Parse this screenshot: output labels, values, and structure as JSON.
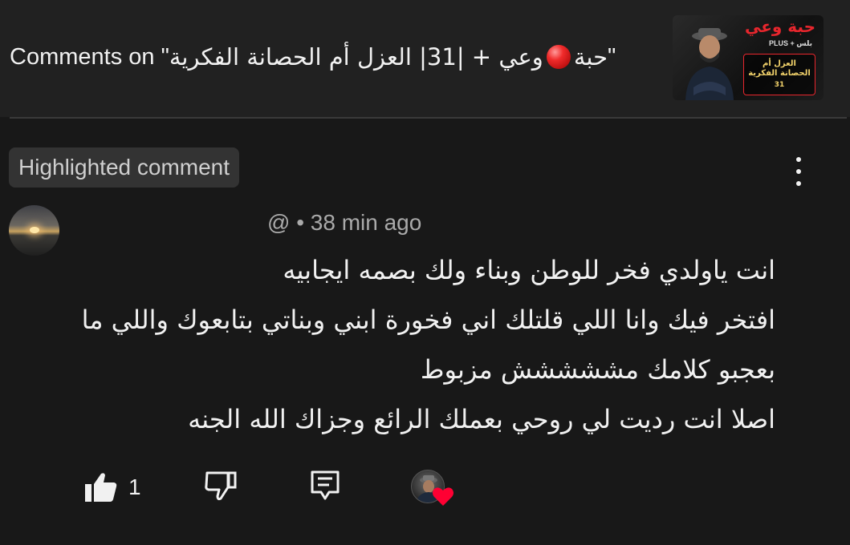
{
  "header": {
    "title_prefix": "Comments on \"",
    "title_arabic_1": "حبة",
    "title_arabic_2": "وعي + |31| العزل أم الحصانة الفكرية",
    "title_suffix": "\"",
    "thumbnail": {
      "title": "حبة وعي",
      "plus_label": "PLUS + بلس",
      "episode_title_line1": "العزل أم",
      "episode_title_line2": "الحصانة الفكرية",
      "episode_number": "31"
    }
  },
  "chip": {
    "label": "Highlighted comment"
  },
  "comment": {
    "meta": "@ • 38 min ago",
    "lines": [
      "انت ياولدي فخر للوطن وبناء ولك بصمه ايجابيه",
      "افتخر فيك وانا اللي قلتلك اني فخورة ابني وبناتي بتابعوك واللي ما",
      "بعجبو كلامك مششششش مزبوط",
      "اصلا انت رديت لي روحي بعملك الرائع وجزاك الله الجنه"
    ]
  },
  "actions": {
    "like_count": "1",
    "icons": [
      "thumbs-up-icon",
      "thumbs-down-icon",
      "reply-icon",
      "creator-heart-icon"
    ]
  },
  "colors": {
    "background": "#181818",
    "header_background": "#212121",
    "chip_background": "#333333",
    "meta_text": "#aaaaaa",
    "heart": "#ff0033"
  }
}
